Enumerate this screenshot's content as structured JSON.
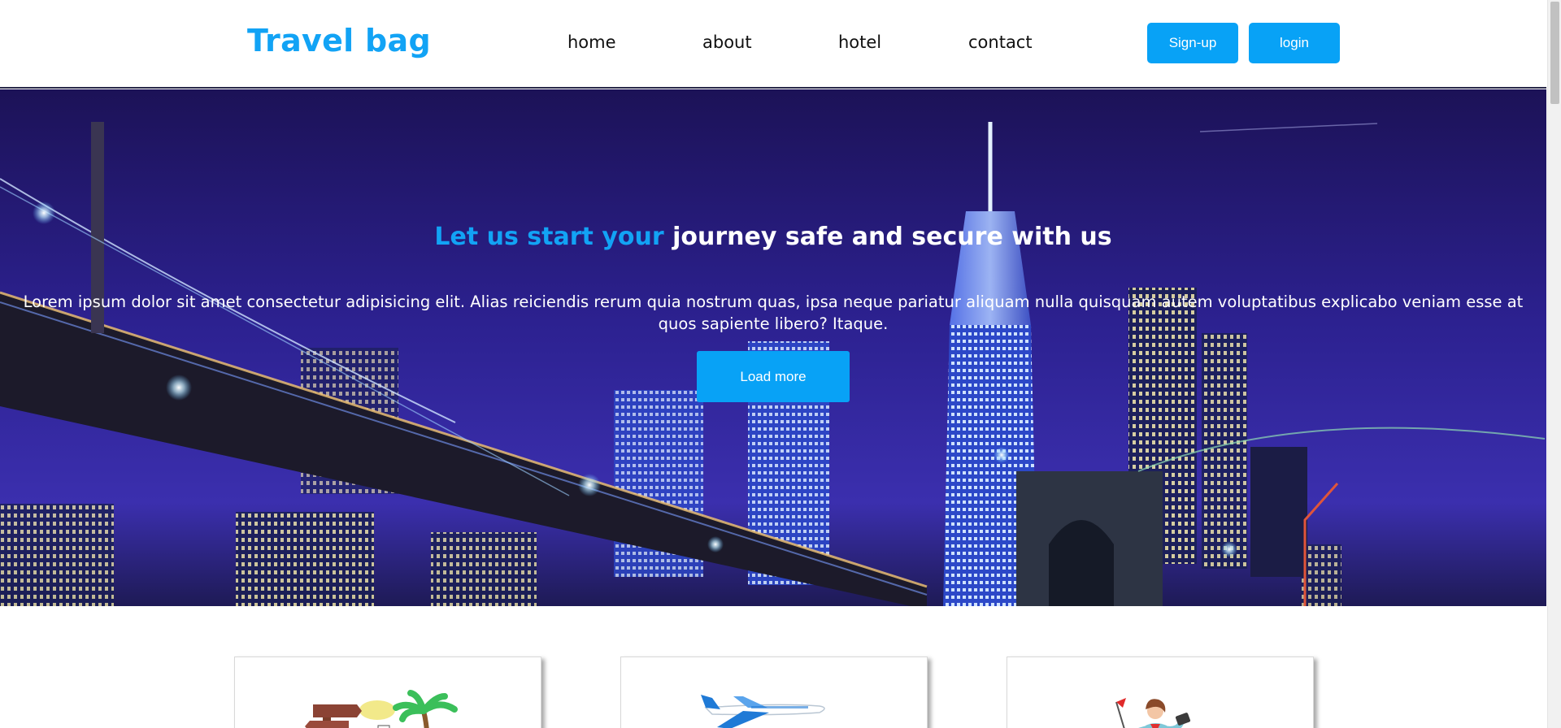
{
  "header": {
    "logo": "Travel bag",
    "nav": [
      "home",
      "about",
      "hotel",
      "contact"
    ],
    "signup_label": "Sign-up",
    "login_label": "login"
  },
  "hero": {
    "title_accent": "Let us start your",
    "title_rest": "journey safe and secure with us",
    "body": "Lorem ipsum dolor sit amet consectetur adipisicing elit. Alias reiciendis rerum quia nostrum quas, ipsa neque pariatur aliquam nulla quisquam autem voluptatibus explicabo veniam esse at quos sapiente libero? Itaque.",
    "button_label": "Load more",
    "background": "night city skyline with bridge"
  },
  "cards": [
    {
      "illustration": "signpost-palm-tree-icon"
    },
    {
      "illustration": "airplane-icon"
    },
    {
      "illustration": "traveler-with-flag-icon"
    }
  ],
  "colors": {
    "accent": "#08a2f6",
    "logo": "#12a3f5",
    "hero_bg": "#2a1f86"
  }
}
